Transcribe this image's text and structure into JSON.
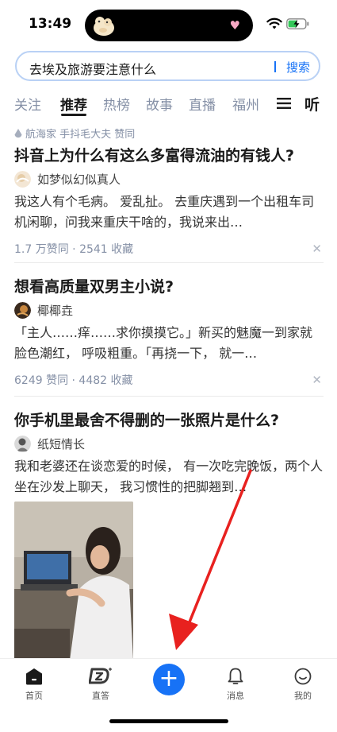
{
  "status_bar": {
    "time": "13:49"
  },
  "search": {
    "query": "去埃及旅游要注意什么",
    "button": "搜索"
  },
  "tabs": {
    "items": [
      "关注",
      "推荐",
      "热榜",
      "故事",
      "直播",
      "福州"
    ],
    "active": "推荐",
    "listen": "听"
  },
  "feed": [
    {
      "meta": "航海家 手抖毛大夫 赞同",
      "title": "抖音上为什么有这么多富得流油的有钱人?",
      "author": "如梦似幻似真人",
      "excerpt": "我这人有个毛病。 爱乱扯。 去重庆遇到一个出租车司机闲聊，问我来重庆干啥的，我说来出…",
      "stats": "1.7 万赞同 · 2541 收藏"
    },
    {
      "title": "想看高质量双男主小说?",
      "author": "椰椰垚",
      "excerpt": "「主人……痒……求你摸摸它。」新买的魅魔一到家就脸色潮红， 呼吸粗重。「再挠一下， 就一…",
      "stats": "6249 赞同 · 4482 收藏"
    },
    {
      "title": "你手机里最舍不得删的一张照片是什么?",
      "author": "纸短情长",
      "excerpt": "我和老婆还在谈恋爱的时候， 有一次吃完晚饭，两个人坐在沙发上聊天， 我习惯性的把脚翘到…"
    }
  ],
  "bottom_nav": {
    "home": "首页",
    "zhida": "直答",
    "messages": "消息",
    "me": "我的"
  },
  "colors": {
    "accent": "#1772f6",
    "annotation_arrow": "#e8211f"
  }
}
